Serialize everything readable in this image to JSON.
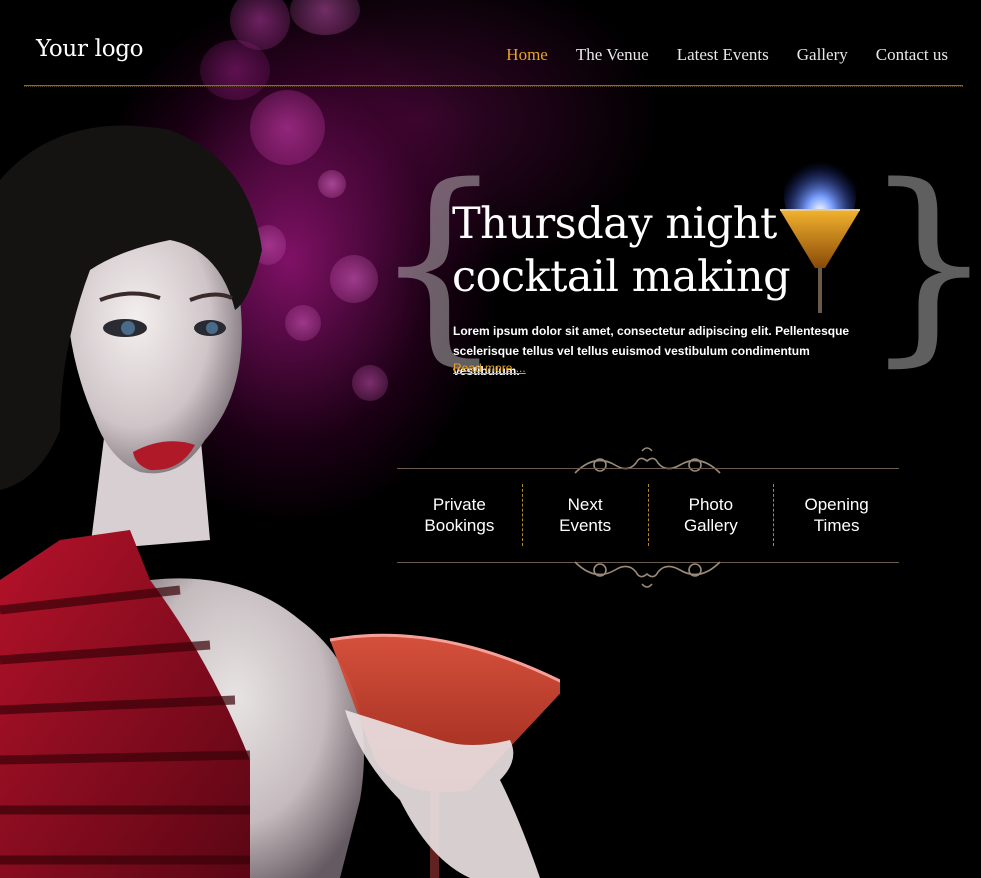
{
  "header": {
    "logo": "Your logo",
    "nav": [
      {
        "label": "Home",
        "active": true
      },
      {
        "label": "The Venue",
        "active": false
      },
      {
        "label": "Latest Events",
        "active": false
      },
      {
        "label": "Gallery",
        "active": false
      },
      {
        "label": "Contact us",
        "active": false
      }
    ]
  },
  "hero": {
    "title_line1": "Thursday night",
    "title_line2": "cocktail making",
    "body": "Lorem ipsum dolor sit amet, consectetur adipiscing elit. Pellentesque scelerisque tellus vel tellus euismod vestibulum  condimentum vestibulum.",
    "read_more": "Read more ..."
  },
  "quick_links": [
    {
      "line1": "Private",
      "line2": "Bookings"
    },
    {
      "line1": "Next",
      "line2": "Events"
    },
    {
      "line1": "Photo",
      "line2": "Gallery"
    },
    {
      "line1": "Opening",
      "line2": "Times"
    }
  ],
  "colors": {
    "accent": "#e8a324",
    "background": "#000000",
    "glow": "#96147a"
  }
}
